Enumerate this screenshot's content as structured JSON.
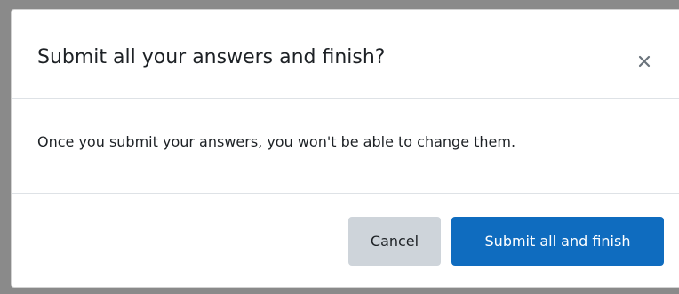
{
  "dialog": {
    "title": "Submit all your answers and finish?",
    "close_icon": "close-icon",
    "message": "Once you submit your answers, you won't be able to change them.",
    "buttons": {
      "cancel_label": "Cancel",
      "submit_label": "Submit all and finish"
    },
    "colors": {
      "primary": "#0f6cbf",
      "secondary": "#ced4da",
      "text": "#1d2125",
      "divider": "#dee2e6"
    }
  }
}
